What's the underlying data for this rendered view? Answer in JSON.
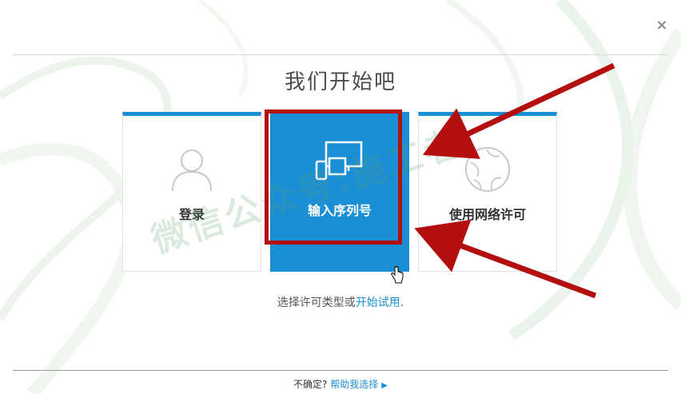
{
  "header": {
    "title": "我们开始吧",
    "close_label": "×"
  },
  "tiles": [
    {
      "id": "login",
      "label": "登录",
      "icon": "person-icon"
    },
    {
      "id": "serial",
      "label": "输入序列号",
      "icon": "devices-icon"
    },
    {
      "id": "network",
      "label": "使用网络许可",
      "icon": "globe-icon"
    }
  ],
  "prompt": {
    "text": "选择许可类型或",
    "link": "开始试用",
    "suffix": "."
  },
  "footer": {
    "text": "不确定?",
    "link": "帮助我选择",
    "arrow": "▶"
  },
  "watermark": "微信公众号:施工者",
  "colors": {
    "accent": "#1a8fd6",
    "annotation": "#b30f0f",
    "watermark": "#5aa06e"
  }
}
